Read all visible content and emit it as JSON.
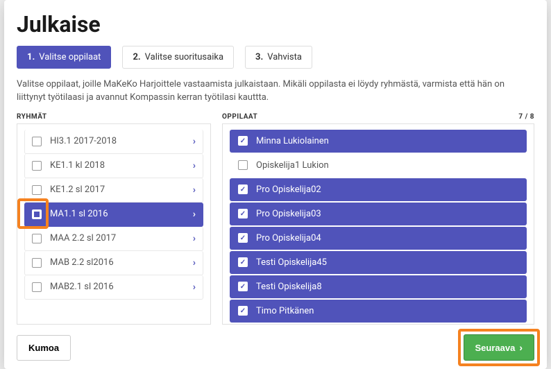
{
  "title": "Julkaise",
  "steps": [
    {
      "num": "1.",
      "label": "Valitse oppilaat",
      "active": true
    },
    {
      "num": "2.",
      "label": "Valitse suoritusaika",
      "active": false
    },
    {
      "num": "3.",
      "label": "Vahvista",
      "active": false
    }
  ],
  "instructions": "Valitse oppilaat, joille MaKeKo Harjoittele vastaamista julkaistaan. Mikäli oppilasta ei löydy ryhmästä, varmista että hän on liittynyt työtilaasi ja avannut Kompassin kerran työtilasi kauttta.",
  "groups_label": "RYHMÄT",
  "students_label": "OPPILAAT",
  "students_count": "7 / 8",
  "groups": [
    {
      "label": "HI3.1 2017-2018",
      "selected": false,
      "indet": false
    },
    {
      "label": "KE1.1 kl 2018",
      "selected": false,
      "indet": false
    },
    {
      "label": "KE1.2 sl 2017",
      "selected": false,
      "indet": false
    },
    {
      "label": "MA1.1 sl 2016",
      "selected": true,
      "indet": true,
      "highlight": true
    },
    {
      "label": "MAA 2.2 sl 2017",
      "selected": false,
      "indet": false
    },
    {
      "label": "MAB 2.2 sl2016",
      "selected": false,
      "indet": false
    },
    {
      "label": "MAB2.1 sl 2016",
      "selected": false,
      "indet": false
    }
  ],
  "students": [
    {
      "label": "Minna Lukiolainen",
      "selected": true
    },
    {
      "label": "Opiskelija1 Lukion",
      "selected": false
    },
    {
      "label": "Pro Opiskelija02",
      "selected": true
    },
    {
      "label": "Pro Opiskelija03",
      "selected": true
    },
    {
      "label": "Pro Opiskelija04",
      "selected": true
    },
    {
      "label": "Testi Opiskelija45",
      "selected": true
    },
    {
      "label": "Testi Opiskelija8",
      "selected": true
    },
    {
      "label": "Timo Pitkänen",
      "selected": true
    }
  ],
  "buttons": {
    "cancel": "Kumoa",
    "next": "Seuraava"
  }
}
